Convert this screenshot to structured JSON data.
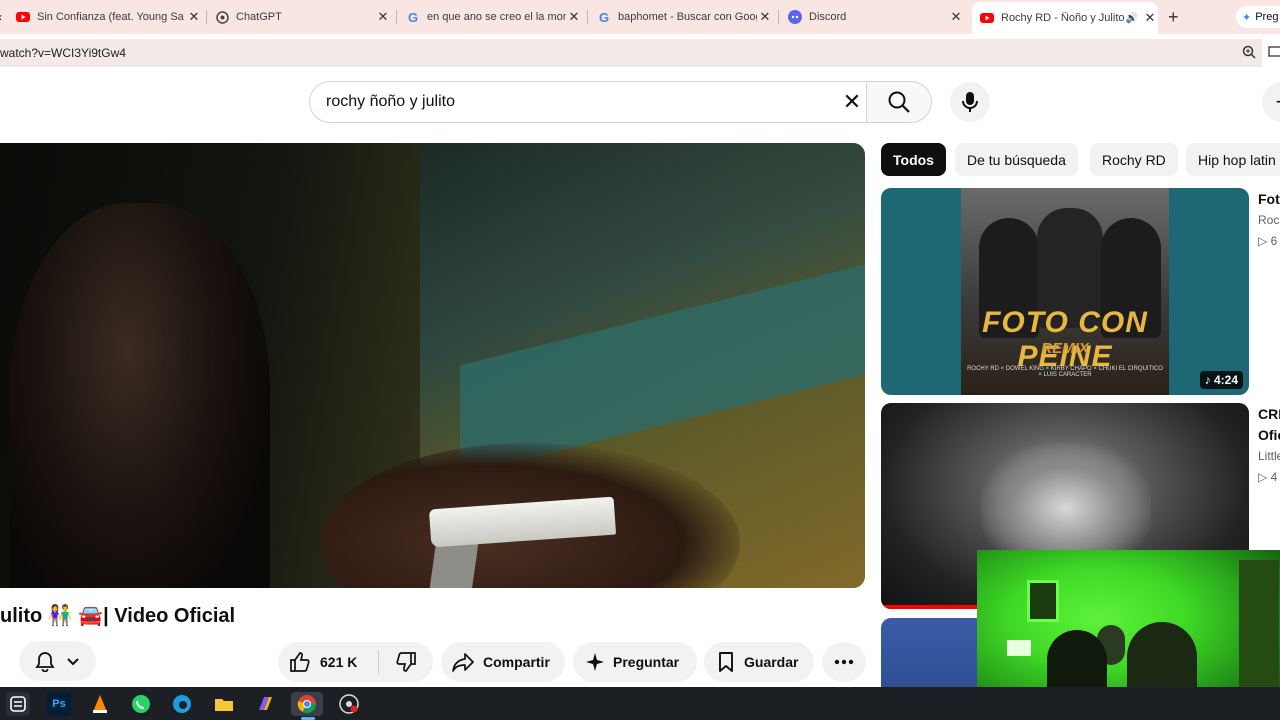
{
  "browser": {
    "tabs": [
      {
        "title": "Sin Confianza (feat. Young Sa",
        "icon": "youtube-icon",
        "color": "#ff0000"
      },
      {
        "title": "ChatGPT",
        "icon": "chatgpt-icon",
        "color": "#3c3c3c"
      },
      {
        "title": "en que ano se creo el la mone",
        "icon": "google-icon",
        "color": "#4285f4"
      },
      {
        "title": "baphomet - Buscar con Googl",
        "icon": "google-icon",
        "color": "#4285f4"
      },
      {
        "title": "Discord",
        "icon": "discord-icon",
        "color": "#5865f2"
      },
      {
        "title": "Rochy RD - Ñoño y Julito [",
        "icon": "youtube-icon",
        "color": "#ff0000",
        "active": true
      }
    ],
    "new_tab": "+",
    "profile_label": "Preg",
    "url": "watch?v=WCI3Yi9tGw4"
  },
  "youtube": {
    "search_query": "rochy ñoño y julito",
    "video_title": "ulito 👫 🚘| Video Oficial",
    "likes": "621 K",
    "share_label": "Compartir",
    "ask_label": "Preguntar",
    "save_label": "Guardar",
    "chips": [
      "Todos",
      "De tu búsqueda",
      "Rochy RD",
      "Hip hop latin"
    ],
    "recommendations": [
      {
        "title_fragment": "Foto",
        "channel_fragment": "Roch",
        "views_fragment": "▷ 6",
        "duration": "4:24",
        "art_title": "FOTO CON PEINE",
        "art_subtitle": "REMIX",
        "art_credits": "ROCHY RD × DOWEL KING × KIRBY CHAPO × CHUKI EL CIRQUITICO × LUIS CARACTER"
      },
      {
        "title_fragment": "CRE",
        "title_fragment_2": "Ofic",
        "channel_fragment": "Little",
        "views_fragment": "▷ 4"
      }
    ]
  },
  "taskbar": {
    "apps": [
      "windows-icon",
      "photoshop-icon",
      "vlc-icon",
      "whatsapp-icon",
      "edge-icon",
      "files-icon",
      "copilot-icon",
      "chrome-icon",
      "obs-icon"
    ],
    "ps_label": "Ps"
  }
}
